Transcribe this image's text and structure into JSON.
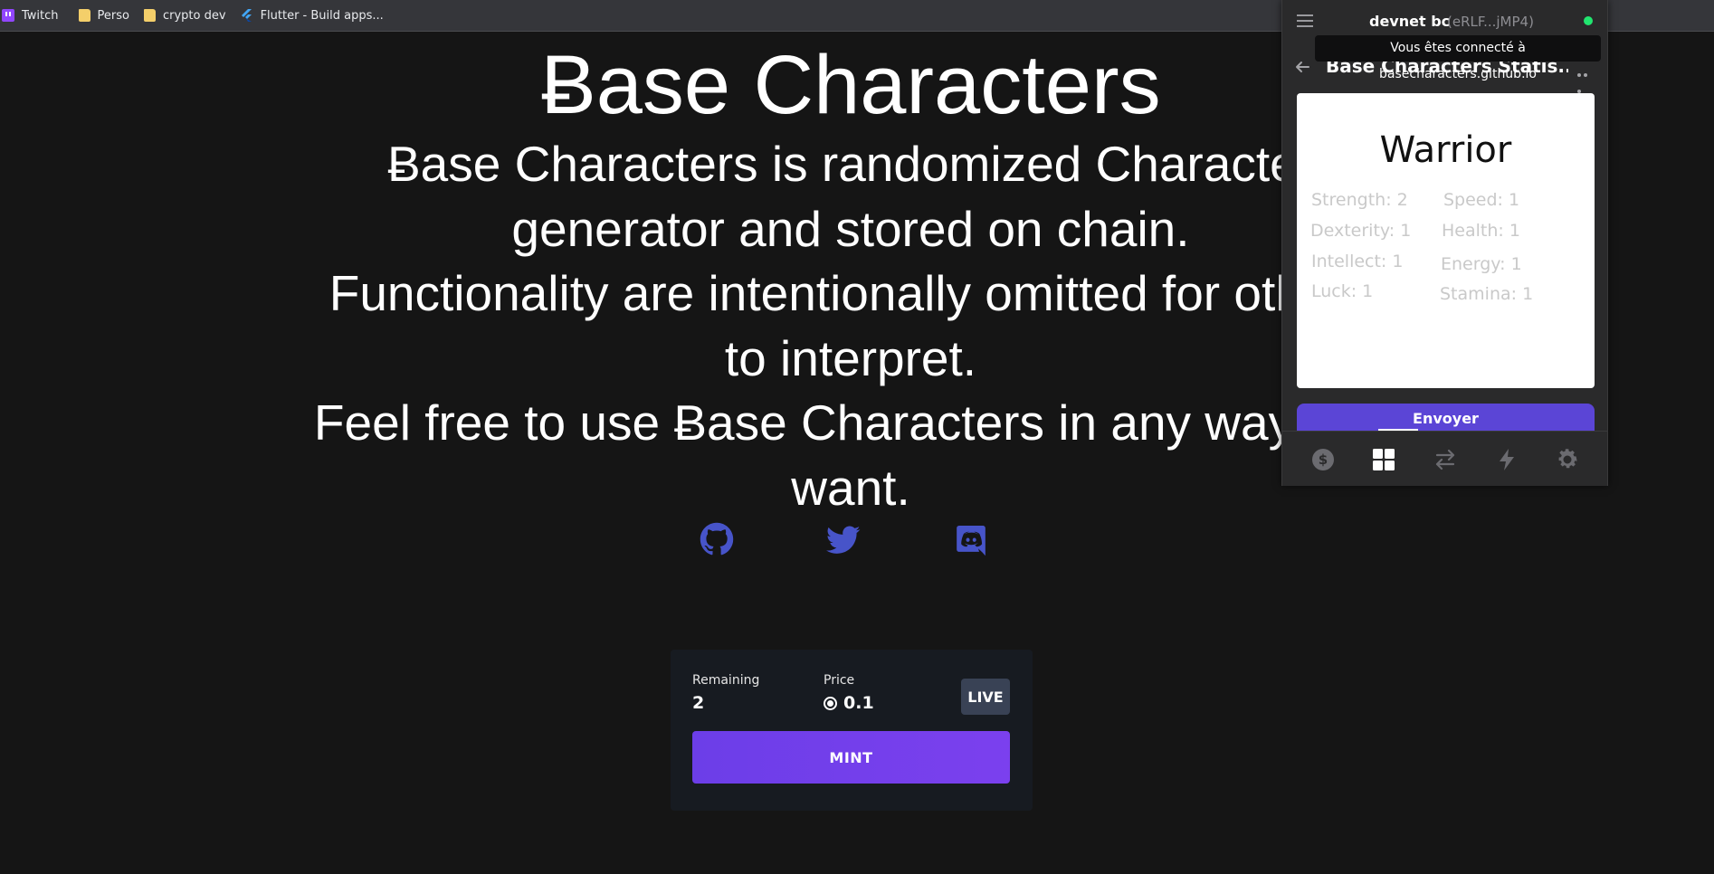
{
  "bookmarks": [
    {
      "label": "Twitch",
      "icon": "twitch-icon"
    },
    {
      "label": "Perso",
      "icon": "folder-icon"
    },
    {
      "label": "crypto dev",
      "icon": "folder-icon"
    },
    {
      "label": "Flutter - Build apps...",
      "icon": "flutter-icon"
    }
  ],
  "main": {
    "title": "Ƀase Characters",
    "description": [
      "Ƀase Characters is randomized Character generator and stored on chain.",
      "Functionality are intentionally omitted for others to interpret.",
      "Feel free to use Ƀase Characters in any way you want."
    ],
    "social_links": [
      "github-icon",
      "twitter-icon",
      "discord-icon"
    ]
  },
  "mint": {
    "remaining_label": "Remaining",
    "remaining_value": "2",
    "price_label": "Price",
    "price_value": "0.1",
    "live_badge": "LIVE",
    "mint_button": "MINT"
  },
  "wallet": {
    "name": "devnet bc",
    "address": "(eRLF...jMP4)",
    "status_color": "#21e56f",
    "tooltip": "Vous êtes connecté à basecharacters.github.io",
    "nft_title": "Base Characters Statis...",
    "nft": {
      "class_name": "Warrior",
      "stats": [
        "Strength: 2",
        "Speed: 1",
        "Dexterity: 1",
        "Health: 1",
        "Intellect: 1",
        "Energy: 1",
        "Luck: 1",
        "Stamina: 1"
      ]
    },
    "send_button": "Envoyer",
    "footer_tabs": [
      "dollar-icon",
      "grid-icon",
      "swap-icon",
      "bolt-icon",
      "gear-icon"
    ],
    "active_tab": "grid-icon"
  },
  "colors": {
    "page_background": "#151515",
    "accent_purple": "#6c3ee8",
    "social_icon_blue": "#4754c9",
    "wallet_background": "#2a2a2b"
  }
}
